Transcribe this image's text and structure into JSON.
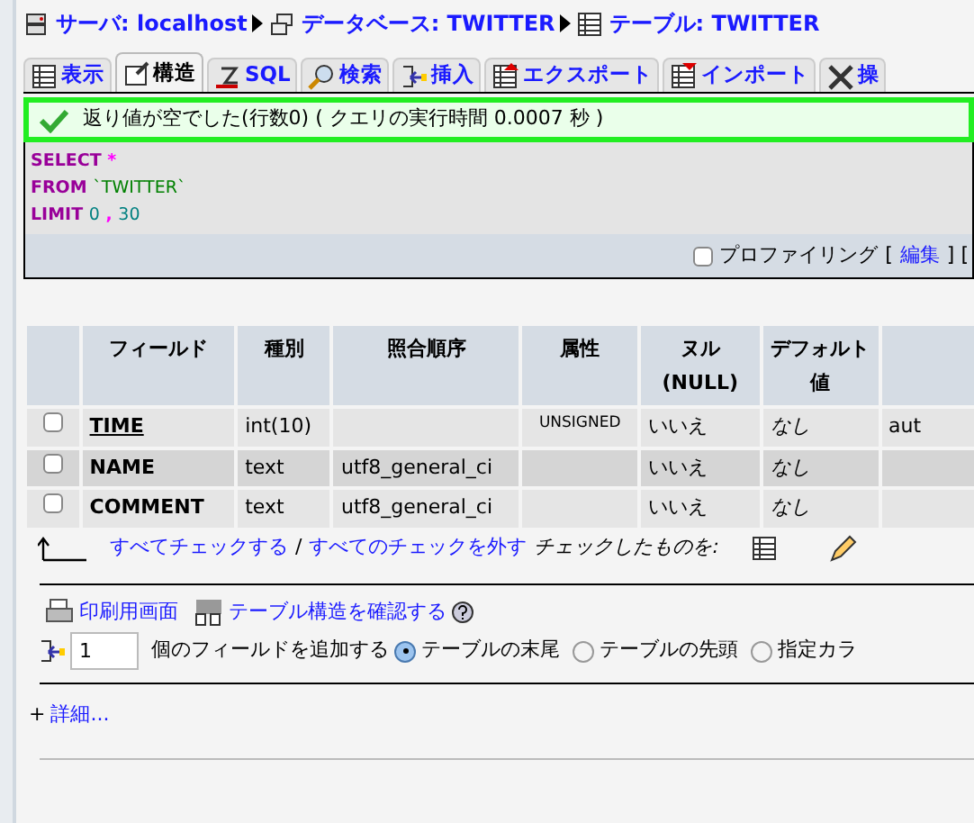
{
  "breadcrumb": [
    {
      "kind": "server",
      "label": "サーバ: localhost"
    },
    {
      "kind": "database",
      "label": "データベース: TWITTER"
    },
    {
      "kind": "table",
      "label": "テーブル: TWITTER"
    }
  ],
  "tabs": [
    {
      "kind": "browse",
      "label": "表示",
      "selected": false
    },
    {
      "kind": "structure",
      "label": "構造",
      "selected": true
    },
    {
      "kind": "sql",
      "label": "SQL",
      "selected": false
    },
    {
      "kind": "search",
      "label": "検索",
      "selected": false
    },
    {
      "kind": "insert",
      "label": "挿入",
      "selected": false
    },
    {
      "kind": "export",
      "label": "エクスポート",
      "selected": false
    },
    {
      "kind": "import",
      "label": "インポート",
      "selected": false
    },
    {
      "kind": "operations",
      "label": "操",
      "selected": false
    }
  ],
  "message": "返り値が空でした(行数0) ( クエリの実行時間 0.0007 秒 )",
  "sql": [
    [
      {
        "kind": "keyword",
        "text": "SELECT"
      },
      {
        "kind": "punct",
        "text": "*"
      }
    ],
    [
      {
        "kind": "keyword",
        "text": "FROM"
      },
      {
        "kind": "string",
        "text": "`TWITTER`"
      }
    ],
    [
      {
        "kind": "keyword",
        "text": "LIMIT"
      },
      {
        "kind": "number",
        "text": "0"
      },
      {
        "kind": "punct",
        "text": ","
      },
      {
        "kind": "number",
        "text": "30"
      }
    ]
  ],
  "profiling": {
    "checked": false,
    "label": "プロファイリング",
    "open_bracket": "[",
    "edit": "編集",
    "close_bracket": "] ["
  },
  "table": {
    "columns": [
      "フィールド",
      "種別",
      "照合順序",
      "属性",
      "ヌル (NULL)",
      "デフォルト値"
    ],
    "rows": [
      {
        "checked": false,
        "primary": true,
        "field": "TIME",
        "type": "int(10)",
        "collation": "",
        "attributes": "UNSIGNED",
        "null": "いいえ",
        "default": "なし",
        "extra": "aut"
      },
      {
        "checked": false,
        "primary": false,
        "field": "NAME",
        "type": "text",
        "collation": "utf8_general_ci",
        "attributes": "",
        "null": "いいえ",
        "default": "なし",
        "extra": ""
      },
      {
        "checked": false,
        "primary": false,
        "field": "COMMENT",
        "type": "text",
        "collation": "utf8_general_ci",
        "attributes": "",
        "null": "いいえ",
        "default": "なし",
        "extra": ""
      }
    ]
  },
  "bulk": {
    "check_all": "すべてチェックする",
    "separator": "/",
    "uncheck_all": "すべてのチェックを外す",
    "with_selected": "チェックしたものを:"
  },
  "links": [
    {
      "kind": "print",
      "label": "印刷用画面"
    },
    {
      "kind": "propose",
      "label": "テーブル構造を確認する"
    }
  ],
  "add_fields": {
    "count": "1",
    "label": "個のフィールドを追加する",
    "positions": [
      {
        "label": "テーブルの末尾",
        "selected": true
      },
      {
        "label": "テーブルの先頭",
        "selected": false
      },
      {
        "label": "指定カラ",
        "selected": false
      }
    ]
  },
  "details": {
    "plus": "+",
    "label": "詳細..."
  }
}
